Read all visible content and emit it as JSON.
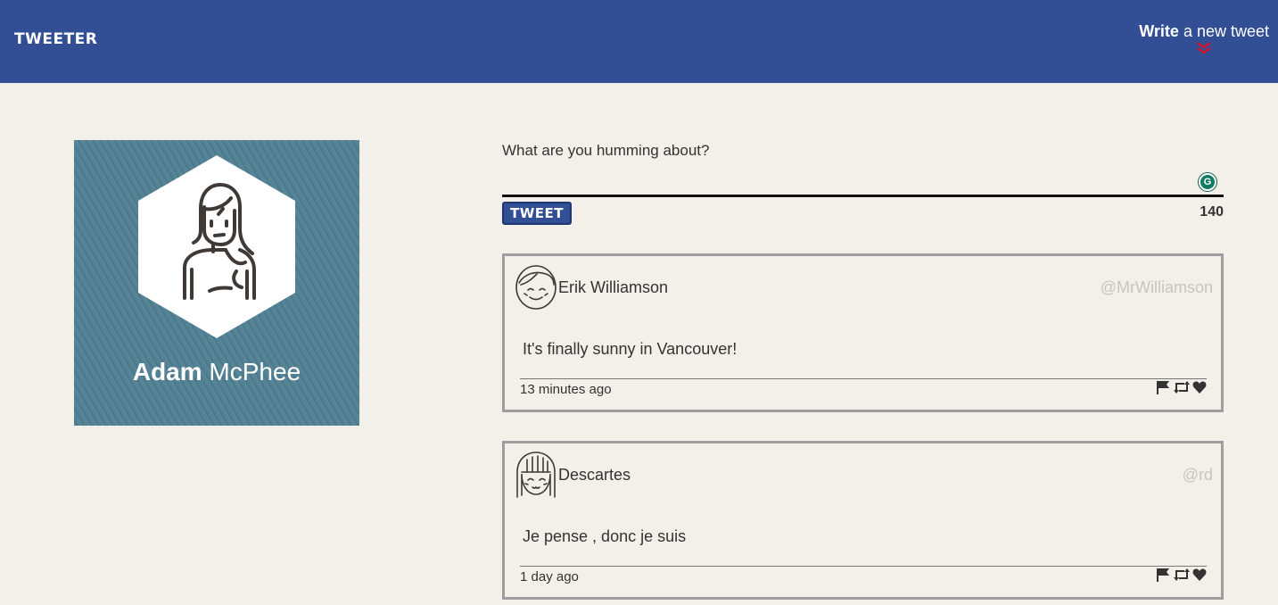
{
  "nav": {
    "brand": "TWEETER",
    "compose_bold": "Write",
    "compose_rest": " a new tweet",
    "chevron_color": "#d0142a"
  },
  "profile": {
    "first_name": "Adam",
    "last_name": " McPhee",
    "avatar_icon": "woman-avatar-icon"
  },
  "compose": {
    "placeholder": "What are you humming about?",
    "button_label": "TWEET",
    "counter": "140"
  },
  "tweets": [
    {
      "name": "Erik Williamson",
      "handle": "@MrWilliamson",
      "text": "It's finally sunny in Vancouver!",
      "time": "13 minutes ago"
    },
    {
      "name": "Descartes",
      "handle": "@rd",
      "text": "Je pense , donc je suis",
      "time": "1 day ago"
    }
  ],
  "colors": {
    "nav_bg": "#324f96",
    "page_bg": "#f3efe9",
    "profile_bg": "#4f7f92"
  }
}
